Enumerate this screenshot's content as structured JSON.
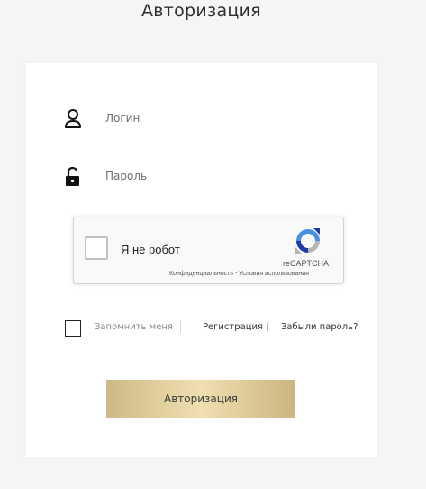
{
  "header": {
    "title": "Авторизация"
  },
  "form": {
    "login": {
      "placeholder": "Логин",
      "icon": "user-icon"
    },
    "password": {
      "placeholder": "Пароль",
      "icon": "lock-open-icon"
    },
    "recaptcha": {
      "checkbox_label": "Я не робот",
      "brand": "reCAPTCHA",
      "terms": "Конфиденциальность - Условия использования",
      "checked": false,
      "colors": {
        "blue": "#4a90e2",
        "dark_blue": "#1c3aa9",
        "gray": "#b4b4b4"
      }
    },
    "remember": {
      "label": "Запомнить меня",
      "checked": false
    },
    "links": {
      "register": "Регистрация |",
      "forgot": "Забыли пароль?"
    },
    "submit_label": "Авторизация"
  },
  "colors": {
    "background": "#f5f5f5",
    "card": "#ffffff",
    "button_gold_start": "#cdb987",
    "button_gold_mid": "#efdfb1",
    "button_gold_end": "#cbb580"
  }
}
